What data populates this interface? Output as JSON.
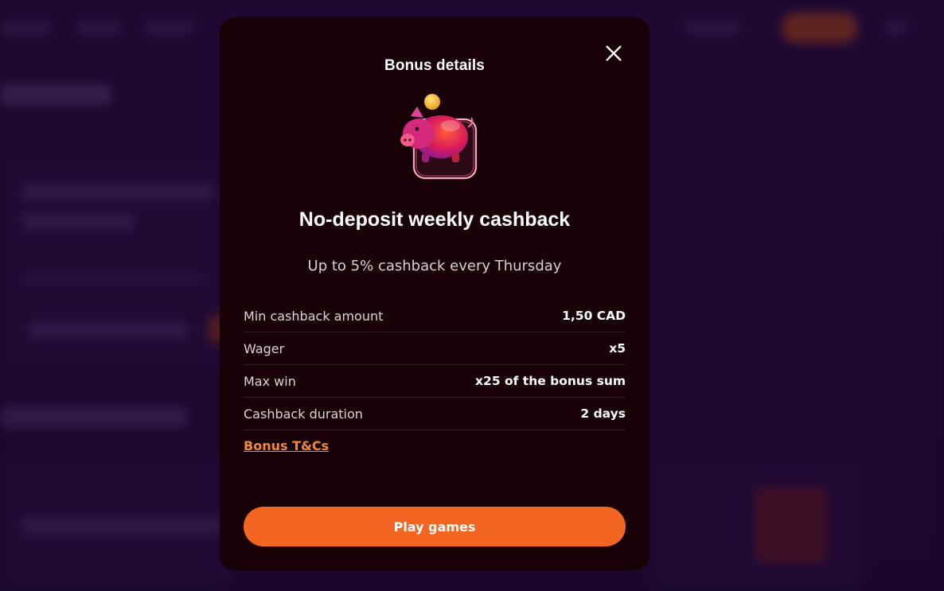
{
  "modal": {
    "title": "Bonus details",
    "bonus_title": "No-deposit weekly cashback",
    "bonus_subtitle": "Up to 5% cashback every Thursday",
    "details": [
      {
        "label": "Min cashback amount",
        "value": "1,50 CAD"
      },
      {
        "label": "Wager",
        "value": "x5"
      },
      {
        "label": "Max win",
        "value": "x25 of the bonus sum"
      },
      {
        "label": "Cashback duration",
        "value": "2 days"
      }
    ],
    "tc_link": "Bonus T&Cs",
    "play_button": "Play games",
    "icons": {
      "close": "close-icon",
      "bonus": "piggy-bank-icon"
    }
  },
  "colors": {
    "modal_bg": "#180208",
    "accent": "#f26522",
    "link": "#f0893a",
    "page_bg": "#2a0d42"
  }
}
